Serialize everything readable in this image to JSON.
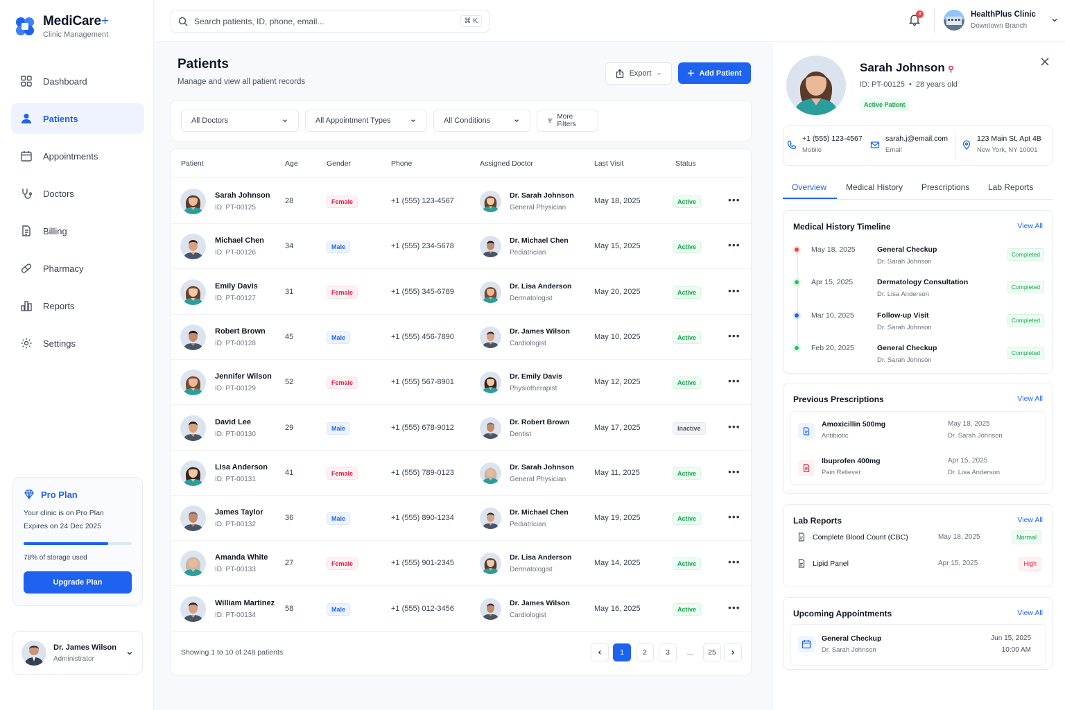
{
  "brand": {
    "name": "MediCare",
    "plus": "+",
    "subtitle": "Clinic Management",
    "accent": "#1d63f0"
  },
  "nav": [
    {
      "label": "Dashboard",
      "icon": "grid-icon"
    },
    {
      "label": "Patients",
      "icon": "user-icon",
      "active": true
    },
    {
      "label": "Appointments",
      "icon": "calendar-icon"
    },
    {
      "label": "Doctors",
      "icon": "stethoscope-icon"
    },
    {
      "label": "Billing",
      "icon": "receipt-icon"
    },
    {
      "label": "Pharmacy",
      "icon": "pill-icon"
    },
    {
      "label": "Reports",
      "icon": "bar-chart-icon"
    },
    {
      "label": "Settings",
      "icon": "gear-icon"
    }
  ],
  "plan": {
    "title": "Pro Plan",
    "line1": "Your clinic is on Pro Plan",
    "line2": "Expires on 24 Dec 2025",
    "storage_used": 0.78,
    "storage_label": "78% of storage used",
    "cta": "Upgrade Plan"
  },
  "user": {
    "name": "Dr. James Wilson",
    "role": "Administrator"
  },
  "search": {
    "placeholder": "Search patients, ID, phone, email...",
    "shortcut": "⌘ K"
  },
  "notifications": {
    "count": "3"
  },
  "clinic": {
    "name": "HealthPlus Clinic",
    "branch": "Downtown Branch"
  },
  "page": {
    "title": "Patients",
    "subtitle": "Manage and view all patient records",
    "export_label": "Export",
    "add_label": "Add Patient"
  },
  "filters": {
    "doctors": "All Doctors",
    "appointment_types": "All Appointment Types",
    "conditions": "All Conditions",
    "more": "More Filters"
  },
  "table": {
    "columns": [
      "Patient",
      "Age",
      "Gender",
      "Phone",
      "Assigned Doctor",
      "Last Visit",
      "Status"
    ],
    "rows": [
      {
        "name": "Sarah Johnson",
        "id": "ID: PT-00125",
        "age": "28",
        "gender": "Female",
        "phone": "+1 (555) 123-4567",
        "doctor": "Dr. Sarah Johnson",
        "specialty": "General Physician",
        "last_visit": "May 18, 2025",
        "status": "Active"
      },
      {
        "name": "Michael Chen",
        "id": "ID: PT-00126",
        "age": "34",
        "gender": "Male",
        "phone": "+1 (555) 234-5678",
        "doctor": "Dr. Michael Chen",
        "specialty": "Pediatrician",
        "last_visit": "May 15, 2025",
        "status": "Active"
      },
      {
        "name": "Emily Davis",
        "id": "ID: PT-00127",
        "age": "31",
        "gender": "Female",
        "phone": "+1 (555) 345-6789",
        "doctor": "Dr. Lisa Anderson",
        "specialty": "Dermatologist",
        "last_visit": "May 20, 2025",
        "status": "Active"
      },
      {
        "name": "Robert Brown",
        "id": "ID: PT-00128",
        "age": "45",
        "gender": "Male",
        "phone": "+1 (555) 456-7890",
        "doctor": "Dr. James Wilson",
        "specialty": "Cardiologist",
        "last_visit": "May 10, 2025",
        "status": "Active"
      },
      {
        "name": "Jennifer Wilson",
        "id": "ID: PT-00129",
        "age": "52",
        "gender": "Female",
        "phone": "+1 (555) 567-8901",
        "doctor": "Dr. Emily Davis",
        "specialty": "Physiotherapist",
        "last_visit": "May 12, 2025",
        "status": "Active"
      },
      {
        "name": "David Lee",
        "id": "ID: PT-00130",
        "age": "29",
        "gender": "Male",
        "phone": "+1 (555) 678-9012",
        "doctor": "Dr. Robert Brown",
        "specialty": "Dentist",
        "last_visit": "May 17, 2025",
        "status": "Inactive"
      },
      {
        "name": "Lisa Anderson",
        "id": "ID: PT-00131",
        "age": "41",
        "gender": "Female",
        "phone": "+1 (555) 789-0123",
        "doctor": "Dr. Sarah Johnson",
        "specialty": "General Physician",
        "last_visit": "May 11, 2025",
        "status": "Active"
      },
      {
        "name": "James Taylor",
        "id": "ID: PT-00132",
        "age": "36",
        "gender": "Male",
        "phone": "+1 (555) 890-1234",
        "doctor": "Dr. Michael Chen",
        "specialty": "Pediatrician",
        "last_visit": "May 19, 2025",
        "status": "Active"
      },
      {
        "name": "Amanda White",
        "id": "ID: PT-00133",
        "age": "27",
        "gender": "Female",
        "phone": "+1 (555) 901-2345",
        "doctor": "Dr. Lisa Anderson",
        "specialty": "Dermatologist",
        "last_visit": "May 14, 2025",
        "status": "Active"
      },
      {
        "name": "William Martinez",
        "id": "ID: PT-00134",
        "age": "58",
        "gender": "Male",
        "phone": "+1 (555) 012-3456",
        "doctor": "Dr. James Wilson",
        "specialty": "Cardiologist",
        "last_visit": "May 16, 2025",
        "status": "Active"
      }
    ],
    "showing": "Showing 1 to 10 of 248 patients",
    "pages": [
      "1",
      "2",
      "3",
      "...",
      "25"
    ]
  },
  "profile": {
    "name": "Sarah Johnson",
    "id": "ID: PT-00125",
    "age": "28 years old",
    "status": "Active Patient",
    "phone": "+1 (555) 123-4567",
    "phone_label": "Mobile",
    "email": "sarah.j@email.com",
    "email_label": "Email",
    "address1": "123 Main St, Apt 4B",
    "address2": "New York, NY 10001",
    "tabs": [
      "Overview",
      "Medical History",
      "Prescriptions",
      "Lab Reports"
    ],
    "view_all": "View All",
    "timeline_title": "Medical History Timeline",
    "timeline": [
      {
        "date": "May 18, 2025",
        "title": "General Checkup",
        "doctor": "Dr. Sarah Johnson",
        "status": "Completed",
        "color": "#ef4444"
      },
      {
        "date": "Apr 15, 2025",
        "title": "Dermatology Consultation",
        "doctor": "Dr. Lisa Anderson",
        "status": "Completed",
        "color": "#22c55e"
      },
      {
        "date": "Mar 10, 2025",
        "title": "Follow-up Visit",
        "doctor": "Dr. Sarah Johnson",
        "status": "Completed",
        "color": "#1d63f0"
      },
      {
        "date": "Feb 20, 2025",
        "title": "General Checkup",
        "doctor": "Dr. Sarah Johnson",
        "status": "Completed",
        "color": "#22c55e"
      }
    ],
    "rx_title": "Previous Prescriptions",
    "prescriptions": [
      {
        "name": "Amoxicillin 500mg",
        "type": "Antibiotic",
        "date": "May 18, 2025",
        "doctor": "Dr. Sarah Johnson",
        "color": "#1d63f0",
        "bg": "#eef4ff"
      },
      {
        "name": "Ibuprofen 400mg",
        "type": "Pain Reliever",
        "date": "Apr 15, 2025",
        "doctor": "Dr. Lisa Anderson",
        "color": "#e11d48",
        "bg": "#fff1f2"
      }
    ],
    "lab_title": "Lab Reports",
    "labs": [
      {
        "name": "Complete Blood Count (CBC)",
        "date": "May 18, 2025",
        "status": "Normal"
      },
      {
        "name": "Lipid Panel",
        "date": "Apr 15, 2025",
        "status": "High"
      }
    ],
    "appt_title": "Upcoming Appointments",
    "appointment": {
      "title": "General Checkup",
      "doctor": "Dr. Sarah Johnson",
      "date": "Jun 15, 2025",
      "time": "10:00 AM"
    }
  }
}
